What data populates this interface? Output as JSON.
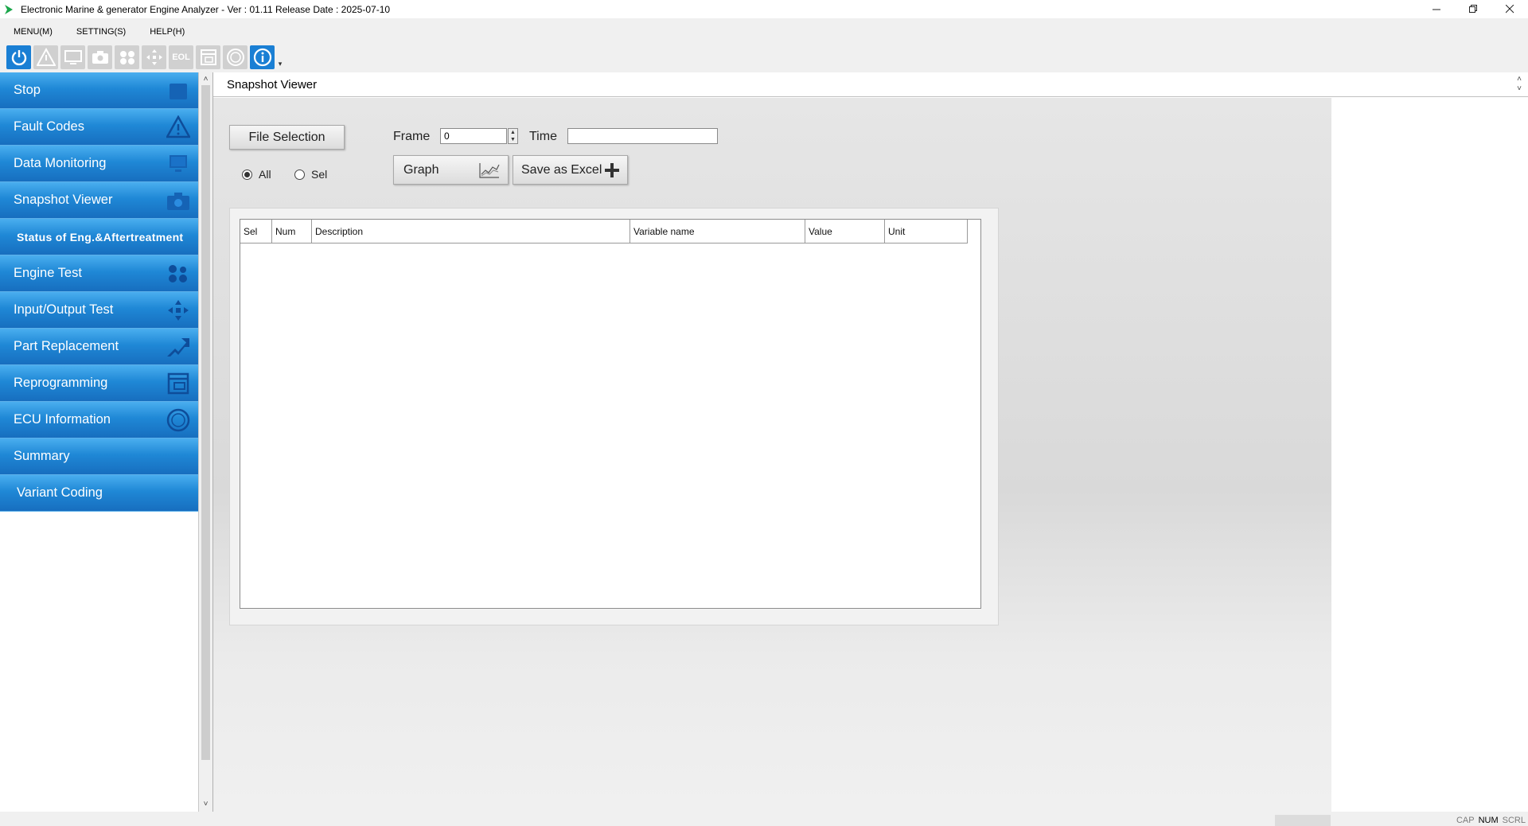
{
  "window": {
    "title": "Electronic Marine & generator Engine Analyzer - Ver : 01.11 Release Date : 2025-07-10",
    "controls": [
      "minimize",
      "restore",
      "close"
    ]
  },
  "menubar": {
    "items": [
      "MENU(M)",
      "SETTING(S)",
      "HELP(H)"
    ]
  },
  "toolbar": {
    "icons": [
      "power-icon",
      "warning-icon",
      "monitor-icon",
      "camera-icon",
      "engine-icon",
      "io-arrows-icon",
      "eol-icon",
      "reprogram-icon",
      "ecu-icon",
      "info-icon"
    ],
    "eol_label": "EOL"
  },
  "sidebar": {
    "items": [
      {
        "label": "Stop",
        "icon": "stop-icon"
      },
      {
        "label": "Fault Codes",
        "icon": "warning-icon"
      },
      {
        "label": "Data Monitoring",
        "icon": "monitor-icon"
      },
      {
        "label": "Snapshot Viewer",
        "icon": "camera-icon"
      },
      {
        "label": "Status of Eng.&Aftertreatment",
        "icon": ""
      },
      {
        "label": "Engine Test",
        "icon": "engine-icon"
      },
      {
        "label": "Input/Output Test",
        "icon": "io-arrows-icon"
      },
      {
        "label": "Part Replacement",
        "icon": "part-replace-icon"
      },
      {
        "label": "Reprogramming",
        "icon": "reprogram-icon"
      },
      {
        "label": "ECU Information",
        "icon": "ecu-icon"
      },
      {
        "label": "Summary",
        "icon": ""
      },
      {
        "label": "Variant Coding",
        "icon": ""
      }
    ]
  },
  "main": {
    "header": "Snapshot Viewer",
    "file_selection_label": "File Selection",
    "radio_all_label": "All",
    "radio_sel_label": "Sel",
    "radio_selected": "All",
    "frame_label": "Frame",
    "frame_value": "0",
    "time_label": "Time",
    "time_value": "",
    "graph_label": "Graph",
    "save_excel_label": "Save as Excel",
    "table": {
      "columns": [
        "Sel",
        "Num",
        "Description",
        "Variable name",
        "Value",
        "Unit"
      ],
      "rows": []
    }
  },
  "statusbar": {
    "keys": [
      "CAP",
      "NUM",
      "SCRL"
    ],
    "active_key": "NUM"
  },
  "colors": {
    "sidebar_blue": "#1f88d6",
    "toolbar_active": "#1a7fd4"
  }
}
